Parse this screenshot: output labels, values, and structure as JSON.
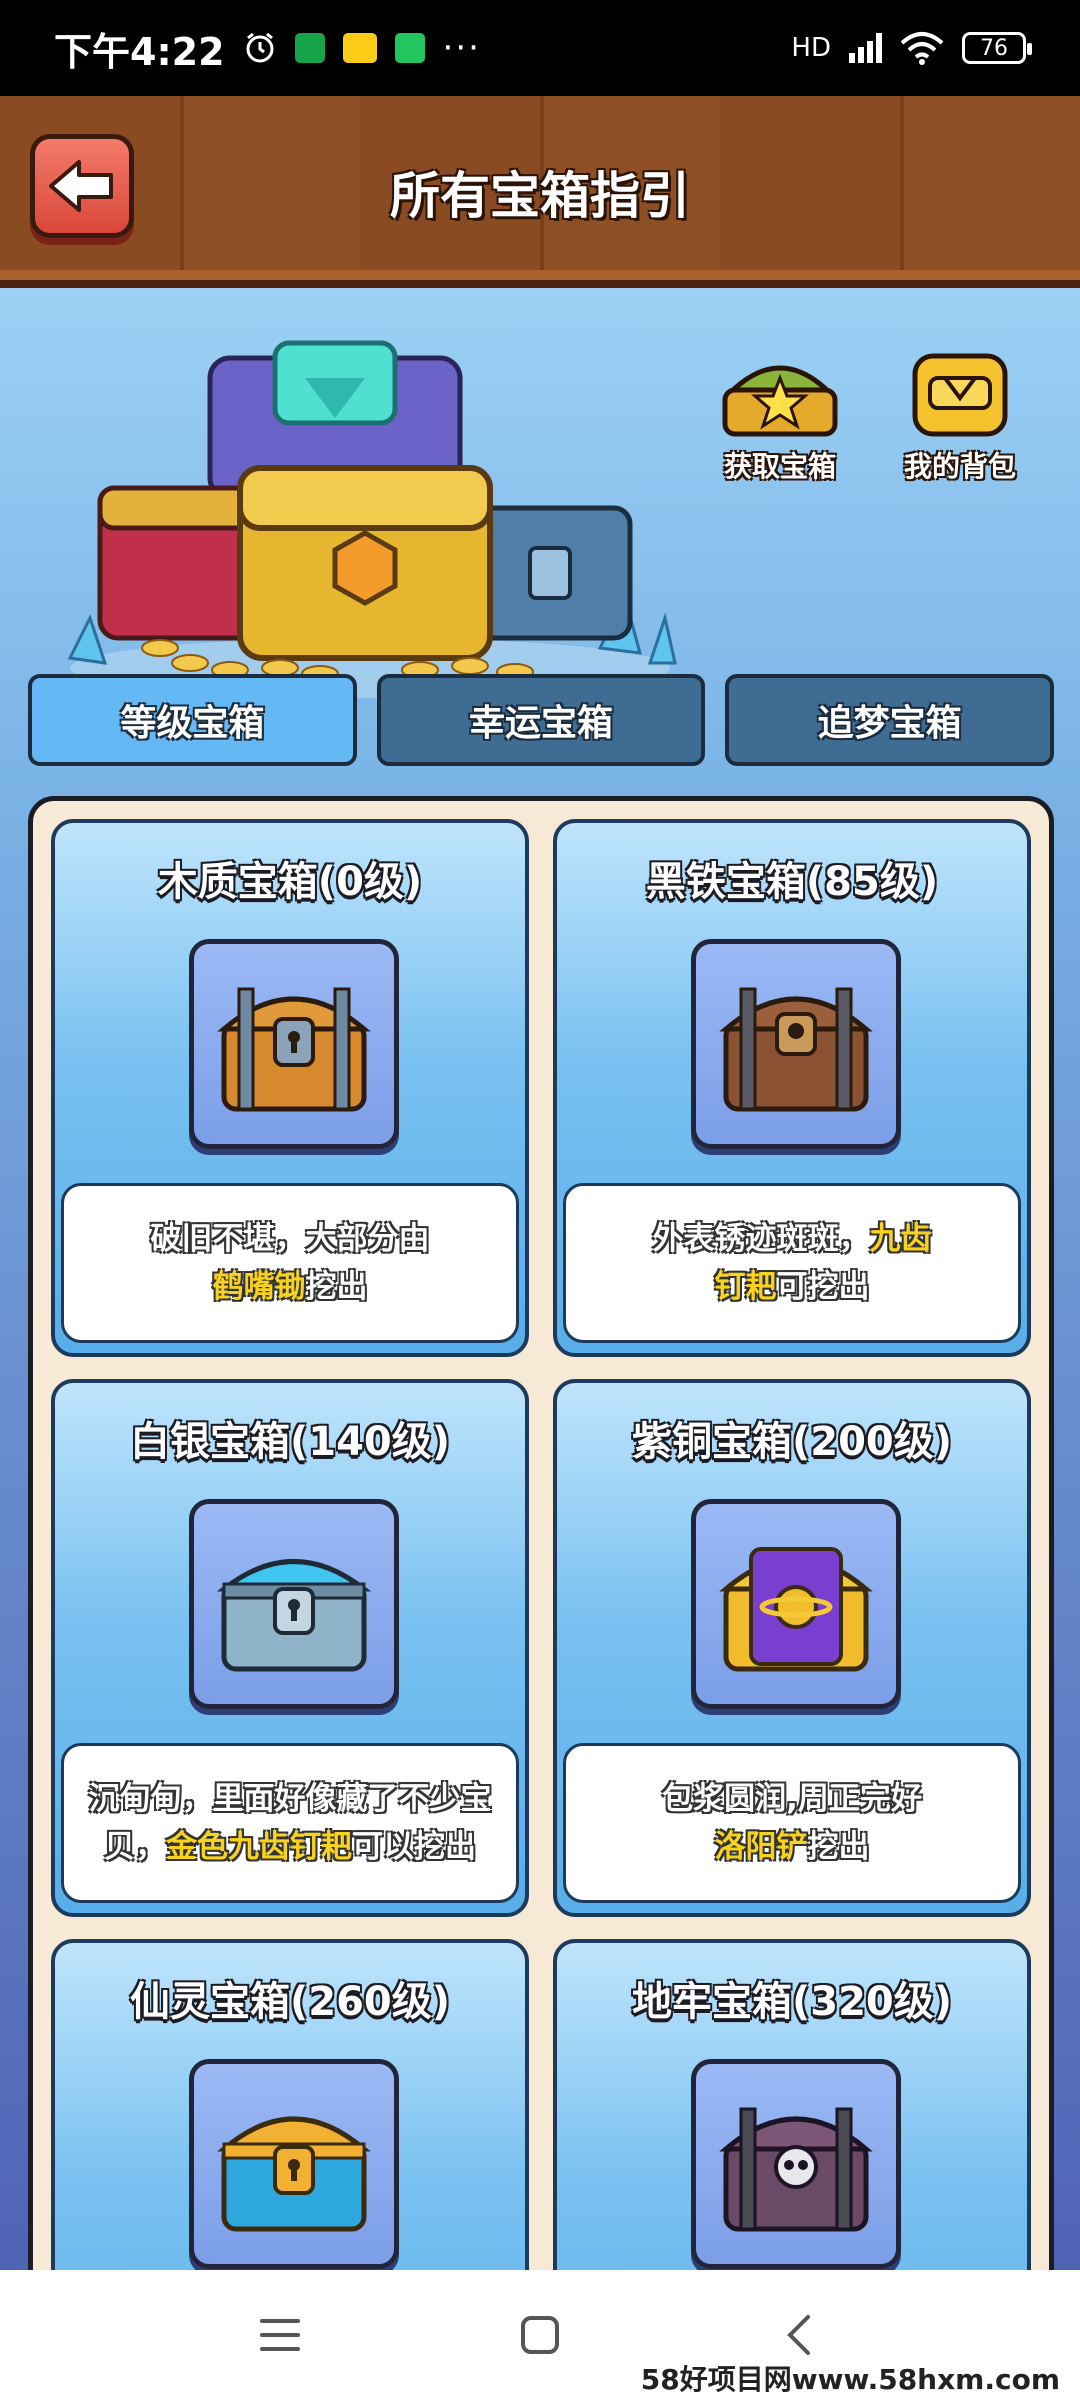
{
  "status_bar": {
    "time": "下午4:22",
    "more": "···",
    "network": "HD",
    "battery": "76"
  },
  "header": {
    "title": "所有宝箱指引",
    "back_icon": "arrow-left-icon"
  },
  "shortcuts": [
    {
      "label": "获取宝箱",
      "icon": "chest-star-icon"
    },
    {
      "label": "我的背包",
      "icon": "backpack-icon"
    }
  ],
  "tabs": [
    {
      "label": "等级宝箱",
      "active": true
    },
    {
      "label": "幸运宝箱",
      "active": false
    },
    {
      "label": "追梦宝箱",
      "active": false
    }
  ],
  "chests": [
    {
      "title": "木质宝箱(0级)",
      "icon": "wooden-chest-icon",
      "desc_line1": "破旧不堪，大部分由",
      "desc_line2_hl": "鹤嘴锄",
      "desc_line2_rest": "挖出"
    },
    {
      "title": "黑铁宝箱(85级)",
      "icon": "iron-chest-icon",
      "desc_line1_pre": "外表锈迹斑斑，",
      "desc_line1_hl": "九齿",
      "desc_line2_hl": "钉耙",
      "desc_line2_rest": "可挖出"
    },
    {
      "title": "白银宝箱(140级)",
      "icon": "silver-chest-icon",
      "desc_line1": "沉甸甸，里面好像藏了不少宝",
      "desc_line2_pre": "贝，",
      "desc_line2_hl": "金色九齿钉耙",
      "desc_line2_rest": "可以挖出"
    },
    {
      "title": "紫铜宝箱(200级)",
      "icon": "purple-gold-chest-icon",
      "desc_line1": "包浆圆润,周正完好",
      "desc_line2_hl": "洛阳铲",
      "desc_line2_rest": "挖出"
    },
    {
      "title": "仙灵宝箱(260级)",
      "icon": "fairy-chest-icon"
    },
    {
      "title": "地牢宝箱(320级)",
      "icon": "dungeon-skull-chest-icon"
    }
  ],
  "watermark": "58好项目网www.58hxm.com",
  "colors": {
    "header_wood": "#8a4a22",
    "tab_active": "#64b8f3",
    "tab_inactive": "#3f6c93",
    "highlight": "#f7d21e",
    "panel_bg": "#f6e9d5"
  }
}
